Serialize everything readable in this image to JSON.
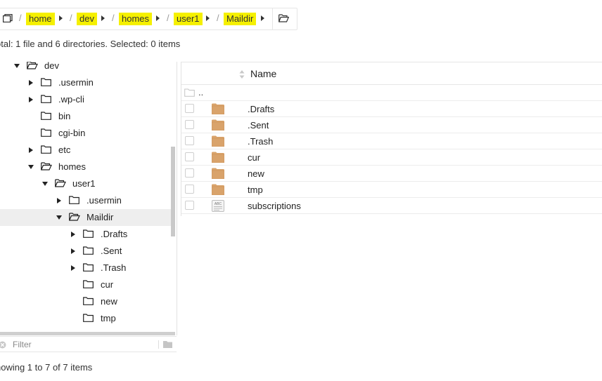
{
  "breadcrumb": {
    "items": [
      {
        "label": "home"
      },
      {
        "label": "dev"
      },
      {
        "label": "homes"
      },
      {
        "label": "user1"
      },
      {
        "label": "Maildir"
      }
    ],
    "highlight_color": "#f5f000"
  },
  "status": {
    "summary": "otal: 1 file and 6 directories. Selected: 0 items",
    "paging": "howing 1 to 7 of 7 items"
  },
  "tree": {
    "items": [
      {
        "label": "dev",
        "expanded": true
      },
      {
        "label": ".usermin"
      },
      {
        "label": ".wp-cli"
      },
      {
        "label": "bin"
      },
      {
        "label": "cgi-bin"
      },
      {
        "label": "etc"
      },
      {
        "label": "homes",
        "expanded": true
      },
      {
        "label": "user1",
        "expanded": true
      },
      {
        "label": ".usermin"
      },
      {
        "label": "Maildir",
        "expanded": true,
        "selected": true
      },
      {
        "label": ".Drafts"
      },
      {
        "label": ".Sent"
      },
      {
        "label": ".Trash"
      },
      {
        "label": "cur"
      },
      {
        "label": "new"
      },
      {
        "label": "tmp"
      }
    ]
  },
  "filter": {
    "placeholder": "Filter"
  },
  "list": {
    "column_name": "Name",
    "parent_label": "..",
    "rows": [
      {
        "name": ".Drafts",
        "type": "folder"
      },
      {
        "name": ".Sent",
        "type": "folder"
      },
      {
        "name": ".Trash",
        "type": "folder"
      },
      {
        "name": "cur",
        "type": "folder"
      },
      {
        "name": "new",
        "type": "folder"
      },
      {
        "name": "tmp",
        "type": "folder"
      },
      {
        "name": "subscriptions",
        "type": "text-file"
      }
    ],
    "folder_color": "#d9a36b"
  }
}
